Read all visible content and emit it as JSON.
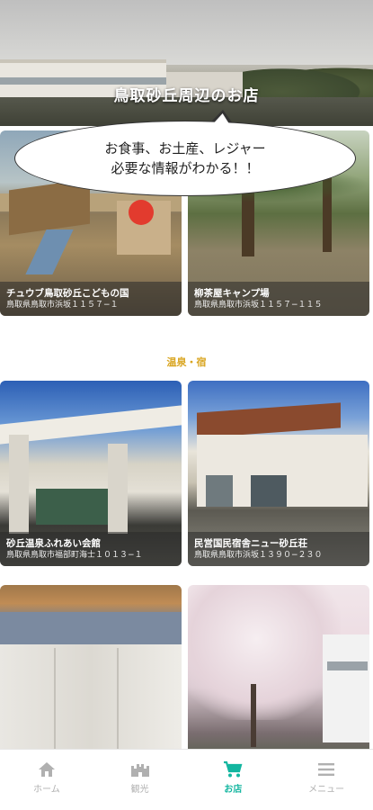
{
  "hero": {
    "title": "鳥取砂丘周辺のお店"
  },
  "bubble": {
    "line1": "お食事、お土産、レジャー",
    "line2": "必要な情報がわかる！！"
  },
  "cards": [
    {
      "name": "チュウブ鳥取砂丘こどもの国",
      "address": "鳥取県鳥取市浜坂１１５７−１"
    },
    {
      "name": "柳茶屋キャンプ場",
      "address": "鳥取県鳥取市浜坂１１５７−１１５"
    },
    {
      "name": "砂丘温泉ふれあい会館",
      "address": "鳥取県鳥取市福部町海士１０１３−１"
    },
    {
      "name": "民営国民宿舎ニュー砂丘荘",
      "address": "鳥取県鳥取市浜坂１３９０−２３０"
    }
  ],
  "section": {
    "label": "温泉・宿"
  },
  "nav": {
    "items": [
      {
        "label": "ホーム",
        "icon": "home-icon"
      },
      {
        "label": "観光",
        "icon": "castle-icon"
      },
      {
        "label": "お店",
        "icon": "cart-icon"
      },
      {
        "label": "メニュー",
        "icon": "menu-icon"
      }
    ],
    "active_index": 2,
    "active_color": "#13b6a0",
    "inactive_color": "#b0b0b0"
  },
  "colors": {
    "accent": "#13b6a0",
    "section_label": "#d9a520"
  }
}
